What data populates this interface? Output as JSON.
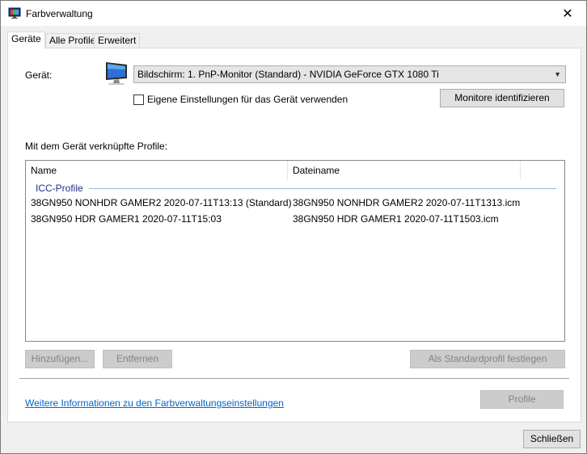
{
  "window": {
    "title": "Farbverwaltung",
    "close_glyph": "✕"
  },
  "tabs": [
    {
      "label": "Geräte",
      "active": true
    },
    {
      "label": "Alle Profile",
      "active": false
    },
    {
      "label": "Erweitert",
      "active": false
    }
  ],
  "device": {
    "label": "Gerät:",
    "selected": "Bildschirm: 1. PnP-Monitor (Standard) - NVIDIA GeForce GTX 1080 Ti",
    "custom_settings_label": "Eigene Einstellungen für das Gerät verwenden",
    "custom_settings_checked": false,
    "identify_button": "Monitore identifizieren"
  },
  "profiles": {
    "section_label": "Mit dem Gerät verknüpfte Profile:",
    "columns": [
      "Name",
      "Dateiname"
    ],
    "group": "ICC-Profile",
    "rows": [
      {
        "name": "38GN950 NONHDR GAMER2 2020-07-11T13:13 (Standard)",
        "file": "38GN950 NONHDR GAMER2 2020-07-11T1313.icm"
      },
      {
        "name": "38GN950 HDR GAMER1 2020-07-11T15:03",
        "file": "38GN950 HDR GAMER1 2020-07-11T1503.icm"
      }
    ]
  },
  "buttons": {
    "add": "Hinzufügen...",
    "remove": "Entfernen",
    "set_default": "Als Standardprofil festlegen",
    "profile": "Profile",
    "close": "Schließen"
  },
  "link": "Weitere Informationen zu den Farbverwaltungseinstellungen"
}
